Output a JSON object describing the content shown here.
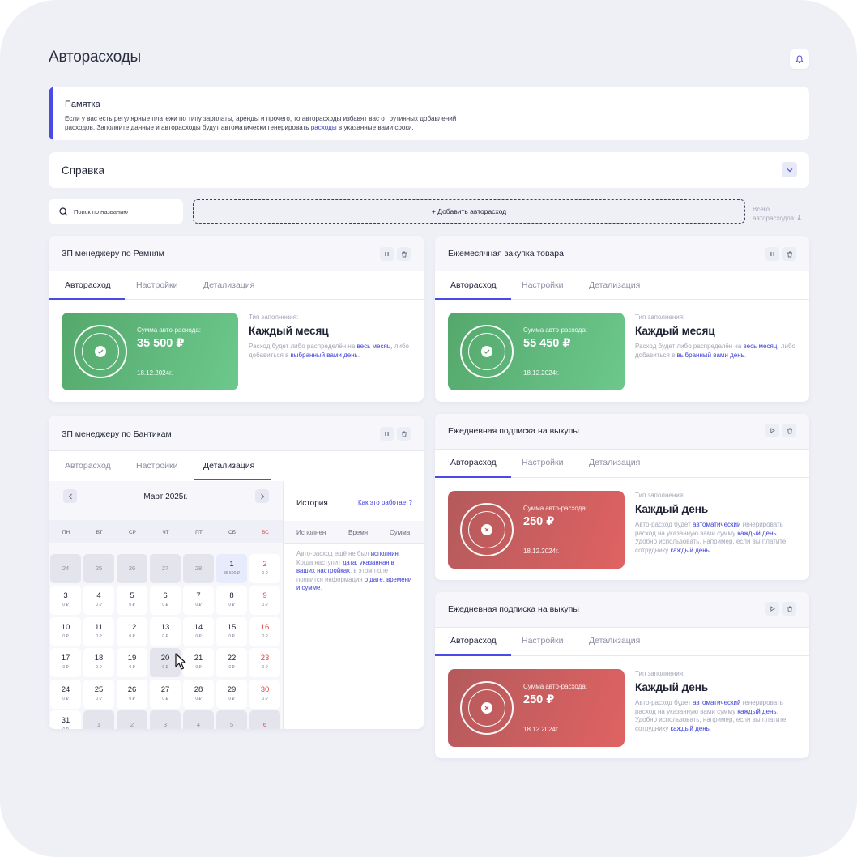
{
  "header": {
    "title": "Авторасходы"
  },
  "memo": {
    "title": "Памятка",
    "text_1": "Если у вас есть регулярные платежи по типу зарплаты, аренды и прочего, то авторасходы избавят вас от рутинных добавлений расходов. Заполните данные и авторасходы будут автоматически генерировать ",
    "link": "расходы",
    "text_2": " в указанные вами сроки."
  },
  "help": {
    "title": "Справка"
  },
  "toolbar": {
    "search_placeholder": "Поиск по названию",
    "add_label": "+ Добавить авторасход",
    "total_line1": "Всего",
    "total_line2": "авторасходов: 4"
  },
  "tabs": {
    "auto": "Авторасход",
    "settings": "Настройки",
    "details": "Детализация"
  },
  "common": {
    "amount_label": "Сумма авто-расхода:",
    "fill_label": "Тип заполнения:",
    "monthly": "Каждый месяц",
    "daily": "Каждый день",
    "monthly_desc_1": "Расход будет либо распределён на ",
    "monthly_link_1": "весь месяц",
    "monthly_desc_2": ", либо добавиться в ",
    "monthly_link_2": "выбранный вами день",
    "monthly_desc_3": ".",
    "daily_desc_1": "Авто-расход будет ",
    "daily_link_1": "автоматический",
    "daily_desc_2": " генерировать расход на указанную вами сумму ",
    "daily_link_2": "каждый день",
    "daily_desc_3": ". Удобно использовать, например, если вы платите сотруднику ",
    "daily_link_3": "каждый день",
    "daily_desc_4": "."
  },
  "cards": [
    {
      "title": "ЗП менеджеру по Ремням",
      "amount": "35 500 ₽",
      "date": "18.12.2024г.",
      "status": "active"
    },
    {
      "title": "Ежемесячная закупка товара",
      "amount": "55 450 ₽",
      "date": "18.12.2024г.",
      "status": "active"
    },
    {
      "title": "ЗП менеджеру по Бантикам"
    },
    {
      "title": "Ежедневная подписка на выкупы",
      "amount": "250 ₽",
      "date": "18.12.2024г.",
      "status": "paused"
    },
    {
      "title": "Ежедневная подписка на выкупы",
      "amount": "250 ₽",
      "date": "18.12.2024г.",
      "status": "paused"
    }
  ],
  "calendar": {
    "month": "Март 2025г.",
    "weekdays": [
      "ПН",
      "ВТ",
      "СР",
      "ЧТ",
      "ПТ",
      "СБ",
      "ВС"
    ],
    "days": [
      {
        "d": "24",
        "v": "",
        "dim": true
      },
      {
        "d": "25",
        "v": "",
        "dim": true
      },
      {
        "d": "26",
        "v": "",
        "dim": true
      },
      {
        "d": "27",
        "v": "",
        "dim": true
      },
      {
        "d": "28",
        "v": "",
        "dim": true
      },
      {
        "d": "1",
        "v": "35 500 ₽",
        "sel": true
      },
      {
        "d": "2",
        "v": "0 ₽",
        "sun": true
      },
      {
        "d": "3",
        "v": "0 ₽"
      },
      {
        "d": "4",
        "v": "0 ₽"
      },
      {
        "d": "5",
        "v": "0 ₽"
      },
      {
        "d": "6",
        "v": "0 ₽"
      },
      {
        "d": "7",
        "v": "0 ₽"
      },
      {
        "d": "8",
        "v": "0 ₽"
      },
      {
        "d": "9",
        "v": "0 ₽",
        "sun": true
      },
      {
        "d": "10",
        "v": "0 ₽"
      },
      {
        "d": "11",
        "v": "0 ₽"
      },
      {
        "d": "12",
        "v": "0 ₽"
      },
      {
        "d": "13",
        "v": "0 ₽"
      },
      {
        "d": "14",
        "v": "0 ₽"
      },
      {
        "d": "15",
        "v": "0 ₽"
      },
      {
        "d": "16",
        "v": "0 ₽",
        "sun": true
      },
      {
        "d": "17",
        "v": "0 ₽"
      },
      {
        "d": "18",
        "v": "0 ₽"
      },
      {
        "d": "19",
        "v": "0 ₽"
      },
      {
        "d": "20",
        "v": "0 ₽",
        "hov": true
      },
      {
        "d": "21",
        "v": "0 ₽"
      },
      {
        "d": "22",
        "v": "0 ₽"
      },
      {
        "d": "23",
        "v": "0 ₽",
        "sun": true
      },
      {
        "d": "24",
        "v": "0 ₽"
      },
      {
        "d": "25",
        "v": "0 ₽"
      },
      {
        "d": "26",
        "v": "0 ₽"
      },
      {
        "d": "27",
        "v": "0 ₽"
      },
      {
        "d": "28",
        "v": "0 ₽"
      },
      {
        "d": "29",
        "v": "0 ₽"
      },
      {
        "d": "30",
        "v": "0 ₽",
        "sun": true
      },
      {
        "d": "31",
        "v": "0 ₽"
      },
      {
        "d": "1",
        "v": "",
        "dim": true
      },
      {
        "d": "2",
        "v": "",
        "dim": true
      },
      {
        "d": "3",
        "v": "",
        "dim": true
      },
      {
        "d": "4",
        "v": "",
        "dim": true
      },
      {
        "d": "5",
        "v": "",
        "dim": true
      },
      {
        "d": "6",
        "v": "",
        "dim": true,
        "sun": true
      }
    ]
  },
  "history": {
    "title": "История",
    "how_link": "Как это работает?",
    "col_executed": "Исполнен",
    "col_time": "Время",
    "col_sum": "Сумма",
    "empty_1": "Авто-расход ещё не был ",
    "empty_link_1": "исполнин",
    "empty_2": ". Когда наступит ",
    "empty_link_2": "дата, указанная в ваших настройках",
    "empty_3": ", в этом поле появится информация ",
    "empty_link_3": "о дате, времени и сумме",
    "empty_4": "."
  },
  "colors": {
    "accent": "#4a4be6",
    "link": "#3b3fd8",
    "green": "#5fb87a",
    "red": "#d05c5e",
    "background": "#efeff6"
  }
}
